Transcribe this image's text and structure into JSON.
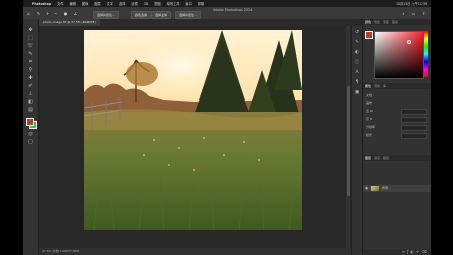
{
  "menubar": {
    "items": [
      "Photoshop",
      "文件",
      "编辑",
      "图像",
      "图层",
      "文字",
      "选择",
      "滤镜",
      "3D",
      "视图",
      "增效工具",
      "窗口",
      "帮助"
    ],
    "clock": "10月13日 上午11:39"
  },
  "window_title": "Adobe Photoshop 2024",
  "options": {
    "button_1": "选择并遮住...",
    "button_2": "颜色选择",
    "button_3": "选择主体",
    "button_4": "选择并遮住..."
  },
  "document_tab": "photo-image.tif @ 37.5% (RGB/8#)",
  "status": "37.5%   文档:7.06M/7.06M",
  "panels": {
    "top_tabs": [
      "颜色",
      "色板",
      "渐变",
      "图案"
    ],
    "properties_tabs": [
      "属性",
      "调整",
      "库"
    ],
    "properties_rows": [
      {
        "label": "文档"
      },
      {
        "label": "画布"
      },
      {
        "label": "宽 W"
      },
      {
        "label": "高 H"
      },
      {
        "label": "分辨率"
      },
      {
        "label": "模式"
      }
    ],
    "layers_tabs": [
      "图层",
      "通道",
      "路径"
    ],
    "layer_name": "背景"
  },
  "colors": {
    "foreground": "#c0392b",
    "background": "#2fbf50"
  }
}
